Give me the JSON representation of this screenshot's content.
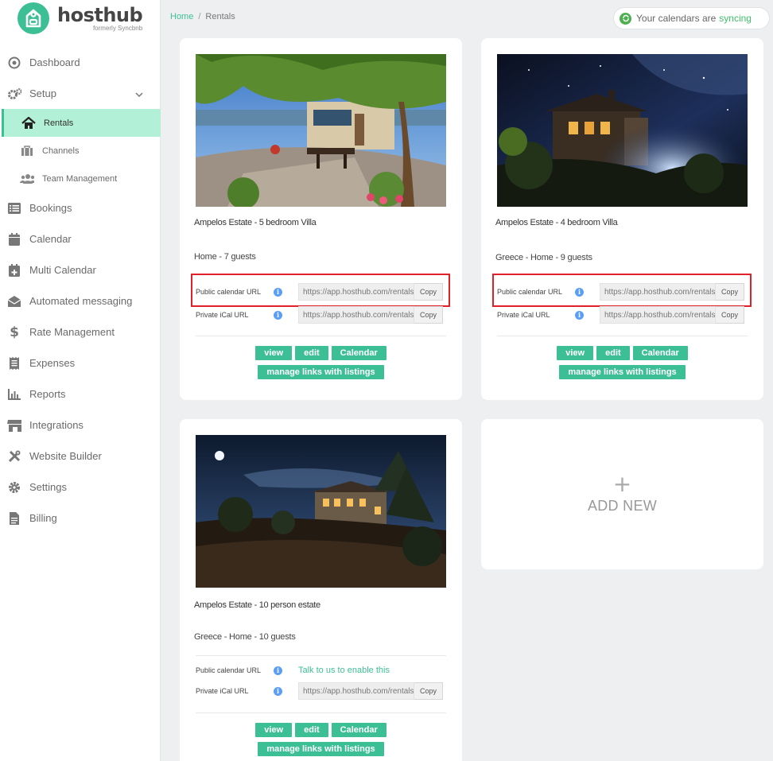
{
  "brand": {
    "name": "hosthub",
    "subtitle": "formerly Syncbnb"
  },
  "breadcrumb": {
    "home": "Home",
    "separator": "/",
    "current": "Rentals"
  },
  "sync": {
    "text": "Your calendars are",
    "status": "syncing"
  },
  "nav": {
    "dashboard": "Dashboard",
    "setup": "Setup",
    "rentals": "Rentals",
    "channels": "Channels",
    "team": "Team Management",
    "bookings": "Bookings",
    "calendar": "Calendar",
    "multi_calendar": "Multi Calendar",
    "automated_messaging": "Automated messaging",
    "rate_management": "Rate Management",
    "expenses": "Expenses",
    "reports": "Reports",
    "integrations": "Integrations",
    "website_builder": "Website Builder",
    "settings": "Settings",
    "billing": "Billing"
  },
  "labels": {
    "public_url": "Public calendar URL",
    "private_url": "Private iCal URL",
    "copy": "Copy",
    "enable": "Talk to us to enable this",
    "view": "view",
    "edit": "edit",
    "calendar": "Calendar",
    "manage": "manage links with listings",
    "url_value": "https://app.hosthub.com/rentals/",
    "add_plus": "+",
    "add_new": "ADD NEW"
  },
  "rentals": [
    {
      "title": "Ampelos Estate - 5 bedroom Villa",
      "meta": "Home - 7 guests"
    },
    {
      "title": "Ampelos Estate - 4 bedroom Villa",
      "meta": "Greece - Home - 9 guests"
    },
    {
      "title": "Ampelos Estate - 10 person estate",
      "meta": "Greece - Home - 10 guests"
    }
  ],
  "colors": {
    "accent": "#3dbf95",
    "highlight": "#e0212a",
    "info": "#5a9ef7"
  }
}
